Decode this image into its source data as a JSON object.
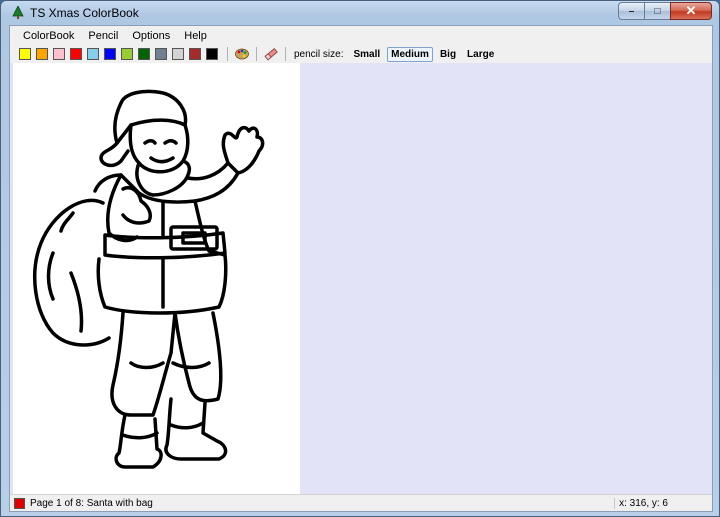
{
  "window": {
    "title": "TS Xmas ColorBook",
    "controls": {
      "minimize": "–",
      "maximize": "□",
      "close": "✕"
    }
  },
  "menu": [
    "ColorBook",
    "Pencil",
    "Options",
    "Help"
  ],
  "toolbar": {
    "palette": [
      {
        "name": "yellow",
        "color": "#ffff00"
      },
      {
        "name": "orange",
        "color": "#ffa500"
      },
      {
        "name": "pink",
        "color": "#ffc0cb"
      },
      {
        "name": "red",
        "color": "#ff0000"
      },
      {
        "name": "light-blue",
        "color": "#87ceeb"
      },
      {
        "name": "blue",
        "color": "#0000ff"
      },
      {
        "name": "yellow-green",
        "color": "#9acd32"
      },
      {
        "name": "dark-green",
        "color": "#006400"
      },
      {
        "name": "gray",
        "color": "#708090"
      },
      {
        "name": "light-gray",
        "color": "#d3d3d3"
      },
      {
        "name": "brown",
        "color": "#a52a2a"
      },
      {
        "name": "black",
        "color": "#000000"
      }
    ],
    "icons": [
      "palette-icon",
      "eraser-icon"
    ],
    "pencil_size_label": "pencil size:",
    "sizes": [
      "Small",
      "Medium",
      "Big",
      "Large"
    ],
    "selected_size": "Medium"
  },
  "status": {
    "current_color": "#e00000",
    "page_text": "Page 1 of 8: Santa with bag",
    "coords": "x: 316, y: 6"
  }
}
